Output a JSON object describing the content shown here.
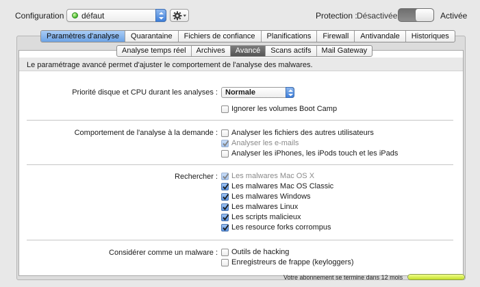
{
  "topbar": {
    "config_label": "Configuration :",
    "config_value": "défaut",
    "protection_label": "Protection :",
    "protection_state": "Désactivée",
    "active_label": "Activée"
  },
  "main_tabs": [
    {
      "label": "Paramètres d'analyse",
      "selected": true
    },
    {
      "label": "Quarantaine",
      "selected": false
    },
    {
      "label": "Fichiers de confiance",
      "selected": false
    },
    {
      "label": "Planifications",
      "selected": false
    },
    {
      "label": "Firewall",
      "selected": false
    },
    {
      "label": "Antivandale",
      "selected": false
    },
    {
      "label": "Historiques",
      "selected": false
    }
  ],
  "sub_tabs": [
    {
      "label": "Analyse temps réel",
      "selected": false
    },
    {
      "label": "Archives",
      "selected": false
    },
    {
      "label": "Avancé",
      "selected": true
    },
    {
      "label": "Scans actifs",
      "selected": false
    },
    {
      "label": "Mail Gateway",
      "selected": false
    }
  ],
  "description": "Le paramétrage avancé permet d'ajuster le comportement de l'analyse des malwares.",
  "priority": {
    "label": "Priorité disque et CPU durant les analyses :",
    "value": "Normale",
    "bootcamp_label": "Ignorer les volumes Boot Camp"
  },
  "ondemand": {
    "label": "Comportement de l'analyse à la demande :",
    "options": [
      {
        "label": "Analyser les fichiers des autres utilisateurs",
        "checked": false,
        "disabled": false
      },
      {
        "label": "Analyser les e-mails",
        "checked": true,
        "disabled": true
      },
      {
        "label": "Analyser les iPhones, les iPods touch et les iPads",
        "checked": false,
        "disabled": false
      }
    ]
  },
  "search": {
    "label": "Rechercher :",
    "options": [
      {
        "label": "Les malwares Mac OS X",
        "checked": true,
        "disabled": true
      },
      {
        "label": "Les malwares Mac OS Classic",
        "checked": true,
        "disabled": false
      },
      {
        "label": "Les malwares Windows",
        "checked": true,
        "disabled": false
      },
      {
        "label": "Les malwares Linux",
        "checked": true,
        "disabled": false
      },
      {
        "label": "Les scripts malicieux",
        "checked": true,
        "disabled": false
      },
      {
        "label": "Les resource forks corrompus",
        "checked": true,
        "disabled": false
      }
    ]
  },
  "malware": {
    "label": "Considérer comme un malware :",
    "options": [
      {
        "label": "Outils de hacking",
        "checked": false,
        "disabled": false
      },
      {
        "label": "Enregistreurs de frappe (keyloggers)",
        "checked": false,
        "disabled": false
      }
    ]
  },
  "footer": {
    "subscription_text": "Votre abonnement se termine dans 12 mois",
    "progress_fraction": 1.0
  },
  "colors": {
    "selected_tab": "#6da3e6",
    "selected_subtab": "#545454",
    "progress_fill": "#c4de2a",
    "status_dot": "#43b52a"
  }
}
